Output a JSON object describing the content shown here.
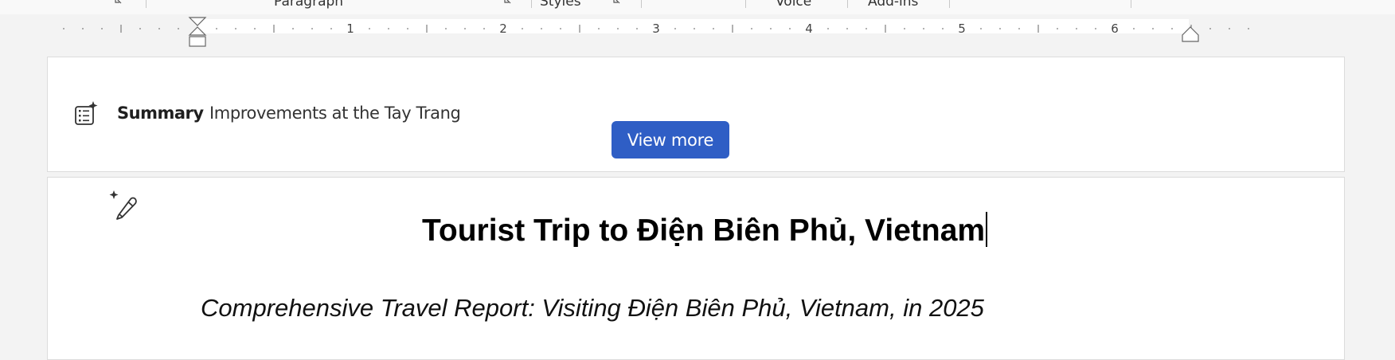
{
  "ribbon": {
    "groups": [
      {
        "label": "Paragraph"
      },
      {
        "label": "Styles"
      },
      {
        "label": "Voice"
      },
      {
        "label": "Add-ins"
      }
    ]
  },
  "ruler": {
    "numbers": [
      "1",
      "2",
      "3",
      "4",
      "5",
      "6"
    ]
  },
  "summary": {
    "label": "Summary",
    "text": "Improvements at the Tay Trang",
    "button": "View more"
  },
  "document": {
    "title": "Tourist Trip to Điện Biên Phủ, Vietnam",
    "subtitle": "Comprehensive Travel Report: Visiting Điện Biên Phủ, Vietnam, in 2025"
  },
  "colors": {
    "accent": "#2f5ec5",
    "workspace": "#f3f3f3"
  }
}
